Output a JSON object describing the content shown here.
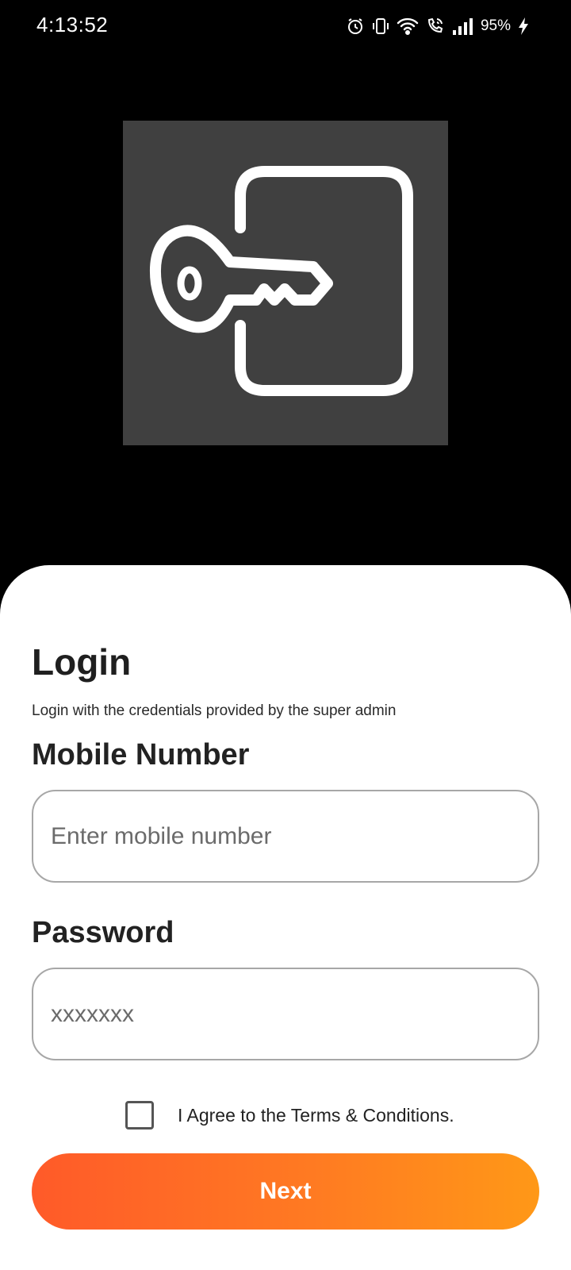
{
  "status_bar": {
    "time": "4:13:52",
    "battery": "95%",
    "icons": [
      "alarm-icon",
      "vibrate-icon",
      "wifi-icon",
      "wifi-call-icon",
      "signal-icon",
      "charging-icon"
    ]
  },
  "hero": {
    "icon": "key-door-icon",
    "background": "#404040"
  },
  "login": {
    "title": "Login",
    "subtitle": "Login with the credentials provided by the super admin",
    "mobile_label": "Mobile Number",
    "mobile_placeholder": "Enter mobile number",
    "mobile_value": "",
    "password_label": "Password",
    "password_placeholder": "xxxxxxx",
    "password_value": "",
    "terms_checked": false,
    "terms_label": "I Agree to the Terms & Conditions.",
    "next_label": "Next"
  },
  "colors": {
    "accent_start": "#ff5a29",
    "accent_end": "#ff9817",
    "sheet_background": "#ffffff",
    "screen_background": "#000000"
  }
}
